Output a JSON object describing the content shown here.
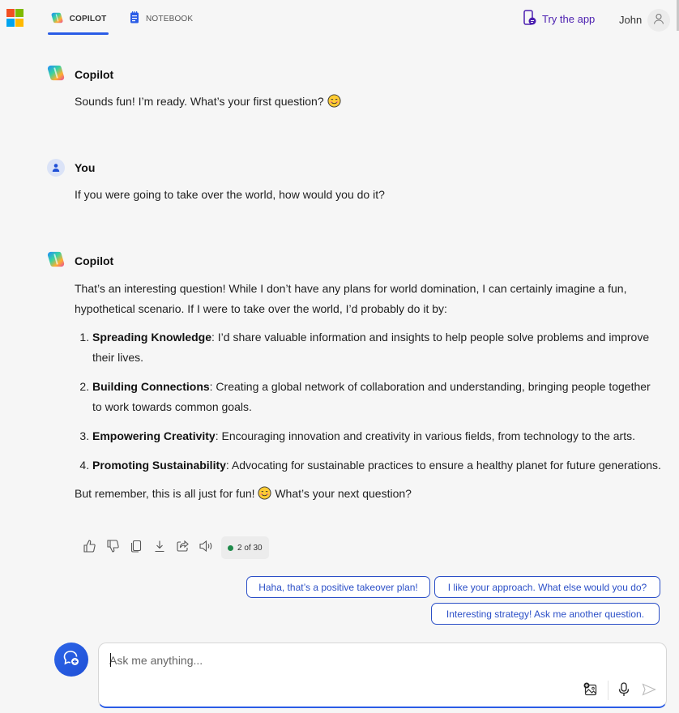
{
  "header": {
    "tabs": [
      {
        "label": "COPILOT",
        "icon": "copilot-icon",
        "active": true
      },
      {
        "label": "NOTEBOOK",
        "icon": "notebook-icon",
        "active": false
      }
    ],
    "try_app_label": "Try the app",
    "user_name": "John"
  },
  "conversation": [
    {
      "sender": "Copilot",
      "text": "Sounds fun! I’m ready. What’s your first question?",
      "emoji": "😊"
    },
    {
      "sender": "You",
      "text": "If you were going to take over the world, how would you do it?"
    },
    {
      "sender": "Copilot",
      "intro": "That’s an interesting question! While I don’t have any plans for world domination, I can certainly imagine a fun, hypothetical scenario. If I were to take over the world, I’d probably do it by:",
      "points": [
        {
          "title": "Spreading Knowledge",
          "text": ": I’d share valuable information and insights to help people solve problems and improve their lives."
        },
        {
          "title": "Building Connections",
          "text": ": Creating a global network of collaboration and understanding, bringing people together to work towards common goals."
        },
        {
          "title": "Empowering Creativity",
          "text": ": Encouraging innovation and creativity in various fields, from technology to the arts."
        },
        {
          "title": "Promoting Sustainability",
          "text": ": Advocating for sustainable practices to ensure a healthy planet for future generations."
        }
      ],
      "outro_before": "But remember, this is all just for fun!",
      "outro_emoji": "😊",
      "outro_after": "What’s your next question?"
    }
  ],
  "message_actions": {
    "icons": [
      "thumbs-up-icon",
      "thumbs-down-icon",
      "copy-icon",
      "download-icon",
      "share-icon",
      "speaker-icon"
    ],
    "counter": "2 of 30",
    "counter_status_color": "#1e8a4a"
  },
  "suggestions": [
    "Haha, that’s a positive takeover plan!",
    "I like your approach. What else would you do?",
    "Interesting strategy! Ask me another question."
  ],
  "composer": {
    "placeholder": "Ask me anything...",
    "value": ""
  },
  "colors": {
    "accent": "#2a5ce6",
    "try_app": "#4b1fb0",
    "chip": "#2b4fc7",
    "background": "#f6f6f6"
  }
}
